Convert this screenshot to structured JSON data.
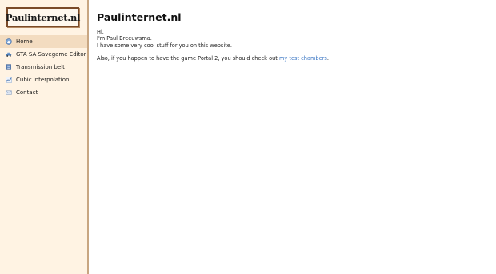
{
  "site": {
    "logo_text": "Paulinternet.nl"
  },
  "sidebar": {
    "items": [
      {
        "label": "Home",
        "icon": "home-icon",
        "active": true
      },
      {
        "label": "GTA SA Savegame Editor",
        "icon": "car-icon",
        "active": false
      },
      {
        "label": "Transmission belt",
        "icon": "document-icon",
        "active": false
      },
      {
        "label": "Cubic interpolation",
        "icon": "curve-icon",
        "active": false
      },
      {
        "label": "Contact",
        "icon": "mail-icon",
        "active": false
      }
    ]
  },
  "main": {
    "title": "Paulinternet.nl",
    "line_1": "Hi.",
    "line_2": "I'm Paul Breeuwsma.",
    "line_3": "I have some very cool stuff for you on this website.",
    "line_4_prefix": "Also, if you happen to have the game Portal 2, you should check out ",
    "line_4_link": "my test chambers",
    "line_4_suffix": "."
  },
  "colors": {
    "sidebar_bg": "#fff3e3",
    "active_item_bg": "#f3dcc0",
    "link": "#3a76c4",
    "logo_border": "#7a4a28"
  }
}
